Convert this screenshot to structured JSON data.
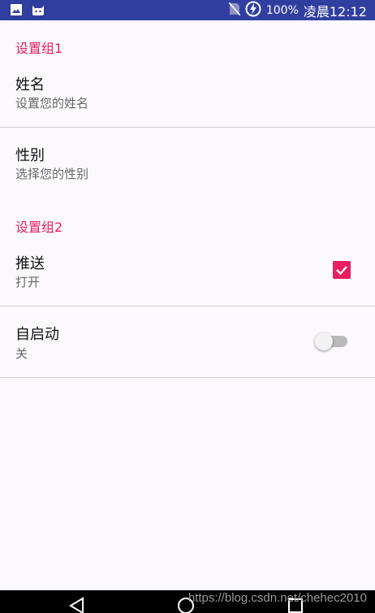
{
  "status_bar": {
    "battery": "100%",
    "clock": "凌晨12:12",
    "icons": [
      "image-icon",
      "app-cat-icon",
      "no-sim-icon",
      "battery-charging-icon"
    ]
  },
  "groups": [
    {
      "title": "设置组1",
      "items": [
        {
          "title": "姓名",
          "summary": "设置您的姓名"
        },
        {
          "title": "性别",
          "summary": "选择您的性别"
        }
      ]
    },
    {
      "title": "设置组2",
      "items": [
        {
          "title": "推送",
          "summary": "打开",
          "checked": true
        },
        {
          "title": "自启动",
          "summary": "关",
          "switch_on": false
        }
      ]
    }
  ],
  "colors": {
    "accent": "#e91e63",
    "status_bar": "#303f9f",
    "background": "#fbf9fd"
  },
  "nav_bar": {
    "buttons": [
      "back-icon",
      "home-icon",
      "recents-icon"
    ],
    "watermark": "https://blog.csdn.net/chehec2010"
  }
}
